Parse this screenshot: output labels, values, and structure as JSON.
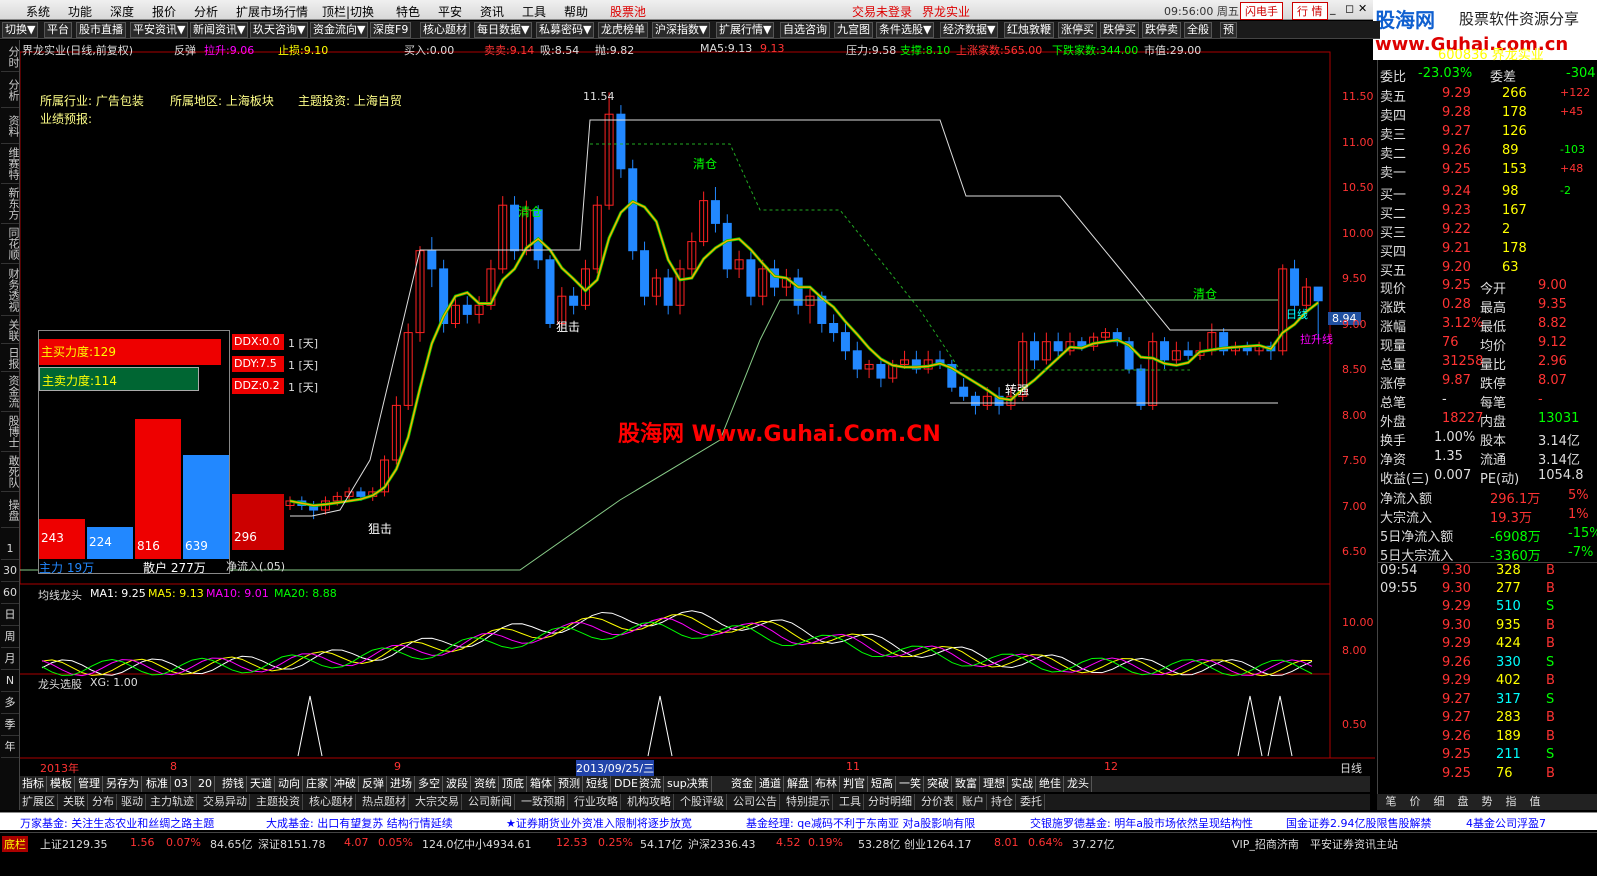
{
  "menu": [
    "系统",
    "功能",
    "深度",
    "报价",
    "分析",
    "扩展市场行情",
    "顶栏|切换",
    "特色",
    "平安",
    "资讯",
    "工具",
    "帮助"
  ],
  "menu_red": [
    "股票池",
    "交易未登录",
    "界龙实业"
  ],
  "clock": "09:56:00 周五",
  "flash_btn": "闪电手",
  "quote_btn": "行 情",
  "logo": {
    "title": "股海网",
    "subtitle": "股票软件资源分享",
    "url": "www.Guhai.com.cn"
  },
  "toolbar": [
    "切换▼",
    "平台",
    "股市直播",
    "平安资讯▼",
    "新闻资讯▼",
    "玖天咨询▼",
    "资金流向▼",
    "深度F9",
    "核心题材",
    "每日数据▼",
    "私募密码▼",
    "龙虎榜单",
    "沪深指数▼",
    "扩展行情▼",
    "自选咨询",
    "九宫图",
    "条件选股▼",
    "经济数据▼",
    "红烛敦鞭",
    "涨停买",
    "跌停买",
    "跌停卖",
    "全般",
    "预"
  ],
  "left_tabs": [
    "分时",
    "分析",
    "资料",
    "维赛特",
    "新东方",
    "同花顺",
    "财务透视",
    "关联",
    "日报",
    "资金流",
    "股博士",
    "敢死队",
    "操盘"
  ],
  "left_small": [
    "1",
    "30",
    "60",
    "日",
    "周",
    "月",
    "N",
    "多",
    "季",
    "年"
  ],
  "chart_header": {
    "title": "界龙实业(日线,前复权)",
    "fantan": "反弹",
    "lasheng": "拉升:9.06",
    "zhisun": "止损:9.10",
    "buy": "买入:0.00",
    "sell": "卖卖:9.14",
    "xi": "吸:8.54",
    "pao": "抛:9.82",
    "ma5": "MA5:9.13",
    "ma5b": "9.13",
    "pressure": "压力:9.58",
    "support": "支撑:8.10",
    "up_count": "上涨家数:565.00",
    "down_count": "下跌家数:344.00",
    "mktval": "市值:29.00"
  },
  "chart_info": {
    "industry": "所属行业: 广告包装",
    "region": "所属地区: 上海板块",
    "theme": "主题投资: 上海自贸",
    "forecast": "业绩预报:"
  },
  "chart_labels": {
    "high": "11.54",
    "qingcang1": "清仓",
    "qingcang2": "清仓",
    "qingcang3": "清仓",
    "zuji1": "狙击",
    "zuji2": "狙击",
    "zhuanqiang": "转强",
    "rixian": "日线",
    "lasheng2": "拉升线",
    "cur": "8.94",
    "watermark": "股海网 Www.Guhai.Com.CN"
  },
  "price_axis": [
    "11.50",
    "11.00",
    "10.50",
    "10.00",
    "9.50",
    "9.00",
    "8.50",
    "8.00",
    "7.50",
    "7.00",
    "6.50"
  ],
  "ddx": {
    "main_buy": "主买力度:129",
    "main_sell": "主卖力度:114",
    "ddx": "DDX:0.0",
    "ddx_n": "1 [天]",
    "ddy": "DDY:7.5",
    "ddy_n": "1 [天]",
    "ddz": "DDZ:0.2",
    "ddz_n": "1 [天]",
    "bars": [
      "243",
      "224",
      "816",
      "639",
      "296"
    ],
    "zhuli": "主力 19万",
    "sanhu": "散户 277万",
    "jingliuru": "净流入(.05)"
  },
  "ma_panel": {
    "title": "均线龙头",
    "ma1": "MA1: 9.25",
    "ma5": "MA5: 9.13",
    "ma10": "MA10: 9.01",
    "ma20": "MA20: 8.88",
    "axis": [
      "10.00",
      "8.00"
    ]
  },
  "xg_panel": {
    "title": "龙头选股",
    "xg": "XG: 1.00",
    "axis": [
      "0.50"
    ]
  },
  "time_axis": {
    "year": "2013年",
    "m8": "8",
    "m9": "9",
    "date": "2013/09/25/三",
    "m11": "11",
    "m12": "12",
    "rx": "日线"
  },
  "bottom_tabs": [
    "指标",
    "模板",
    "管理",
    "另存为",
    "标准",
    "03",
    "20",
    "捞钱",
    "天道",
    "动向",
    "庄家",
    "冲破",
    "反弹",
    "进场",
    "多空",
    "波段",
    "资统",
    "顶底",
    "箱体",
    "预测",
    "短线",
    "DDE",
    "资流",
    "sup决策",
    "资金",
    "通道",
    "解盘",
    "布林",
    "判官",
    "短高",
    "一笑",
    "突破",
    "致富",
    "理想",
    "实战",
    "绝佳",
    "龙头"
  ],
  "bottom_tabs2": [
    "扩展区",
    "关联",
    "分布",
    "驱动",
    "主力轨迹",
    "交易异动",
    "主题投资",
    "核心题材",
    "热点题材",
    "大宗交易",
    "公司新闻",
    "一致预期",
    "行业攻略",
    "机构攻略",
    "个股评级",
    "公司公告",
    "特别提示",
    "工具",
    "分时明细",
    "分价表",
    "账户",
    "持仓",
    "委托"
  ],
  "right_tabs": [
    "笔",
    "价",
    "细",
    "盘",
    "势",
    "指",
    "值"
  ],
  "quote": {
    "code": "600836 界龙实业",
    "wb": [
      "委比",
      "-23.03%",
      "委差",
      "-304"
    ],
    "asks": [
      [
        "卖五",
        "9.29",
        "266",
        "+122"
      ],
      [
        "卖四",
        "9.28",
        "178",
        "+45"
      ],
      [
        "卖三",
        "9.27",
        "126",
        ""
      ],
      [
        "卖二",
        "9.26",
        "89",
        "-103"
      ],
      [
        "卖一",
        "9.25",
        "153",
        "+48"
      ]
    ],
    "bids": [
      [
        "买一",
        "9.24",
        "98",
        "-2"
      ],
      [
        "买二",
        "9.23",
        "167",
        ""
      ],
      [
        "买三",
        "9.22",
        "2",
        ""
      ],
      [
        "买四",
        "9.21",
        "178",
        ""
      ],
      [
        "买五",
        "9.20",
        "63",
        ""
      ]
    ],
    "stats": [
      [
        "现价",
        "9.25",
        "今开",
        "9.00"
      ],
      [
        "涨跌",
        "0.28",
        "最高",
        "9.35"
      ],
      [
        "涨幅",
        "3.12%",
        "最低",
        "8.82"
      ],
      [
        "现量",
        "76",
        "均价",
        "9.12"
      ],
      [
        "总量",
        "31258",
        "量比",
        "2.96"
      ],
      [
        "涨停",
        "9.87",
        "跌停",
        "8.07"
      ],
      [
        "总笔",
        "-",
        "每笔",
        "-"
      ],
      [
        "外盘",
        "18227",
        "内盘",
        "13031"
      ]
    ],
    "stats2": [
      [
        "换手",
        "1.00%",
        "股本",
        "3.14亿"
      ],
      [
        "净资",
        "1.35",
        "流通",
        "3.14亿"
      ],
      [
        "收益(三)",
        "0.007",
        "PE(动)",
        "1054.8"
      ]
    ],
    "flows": [
      [
        "净流入额",
        "296.1万",
        "5%"
      ],
      [
        "大宗流入",
        "19.3万",
        "1%"
      ],
      [
        "5日净流入额",
        "-6908万",
        "-15%"
      ],
      [
        "5日大宗流入",
        "-3360万",
        "-7%"
      ]
    ],
    "ticks": [
      [
        "09:54",
        "9.30",
        "328",
        "B"
      ],
      [
        "09:55",
        "9.30",
        "277",
        "B"
      ],
      [
        "",
        "9.29",
        "510",
        "S"
      ],
      [
        "",
        "9.30",
        "935",
        "B"
      ],
      [
        "",
        "9.29",
        "424",
        "B"
      ],
      [
        "",
        "9.26",
        "330",
        "S"
      ],
      [
        "",
        "9.29",
        "402",
        "B"
      ],
      [
        "",
        "9.27",
        "317",
        "S"
      ],
      [
        "",
        "9.27",
        "283",
        "B"
      ],
      [
        "",
        "9.26",
        "189",
        "B"
      ],
      [
        "",
        "9.25",
        "211",
        "S"
      ],
      [
        "",
        "9.25",
        "76",
        "B"
      ]
    ]
  },
  "news": [
    "万家基金: 关注生态农业和丝绸之路主题",
    "大成基金: 出口有望复苏 结构行情延续",
    "★证券期货业外资准入限制将逐步放宽",
    "基金经理: qe减码不利于东南亚 对a股影响有限",
    "交银施罗德基金: 明年a股市场依然呈现结构性",
    "国金证券2.94亿股限售股解禁",
    "4基金公司浮盈7"
  ],
  "status": {
    "label": "底栏",
    "sh": "上证2129.35",
    "sh_chg": "1.56",
    "sh_pct": "0.07%",
    "sh_amt": "84.65亿",
    "sz": "深证8151.78",
    "sz_chg": "4.07",
    "sz_pct": "0.05%",
    "sz_amt": "124.0亿",
    "zx": "中小4934.61",
    "zx_chg": "12.53",
    "zx_pct": "0.25%",
    "zx_amt": "54.17亿",
    "hs": "沪深2336.43",
    "hs_chg": "4.52",
    "hs_pct": "0.19%",
    "hs_amt": "53.28亿",
    "cy": "创业1264.17",
    "cy_chg": "8.01",
    "cy_pct": "0.64%",
    "cy_amt": "37.27亿",
    "vip": "VIP_招商济南",
    "broker": "平安证券资讯主站"
  }
}
